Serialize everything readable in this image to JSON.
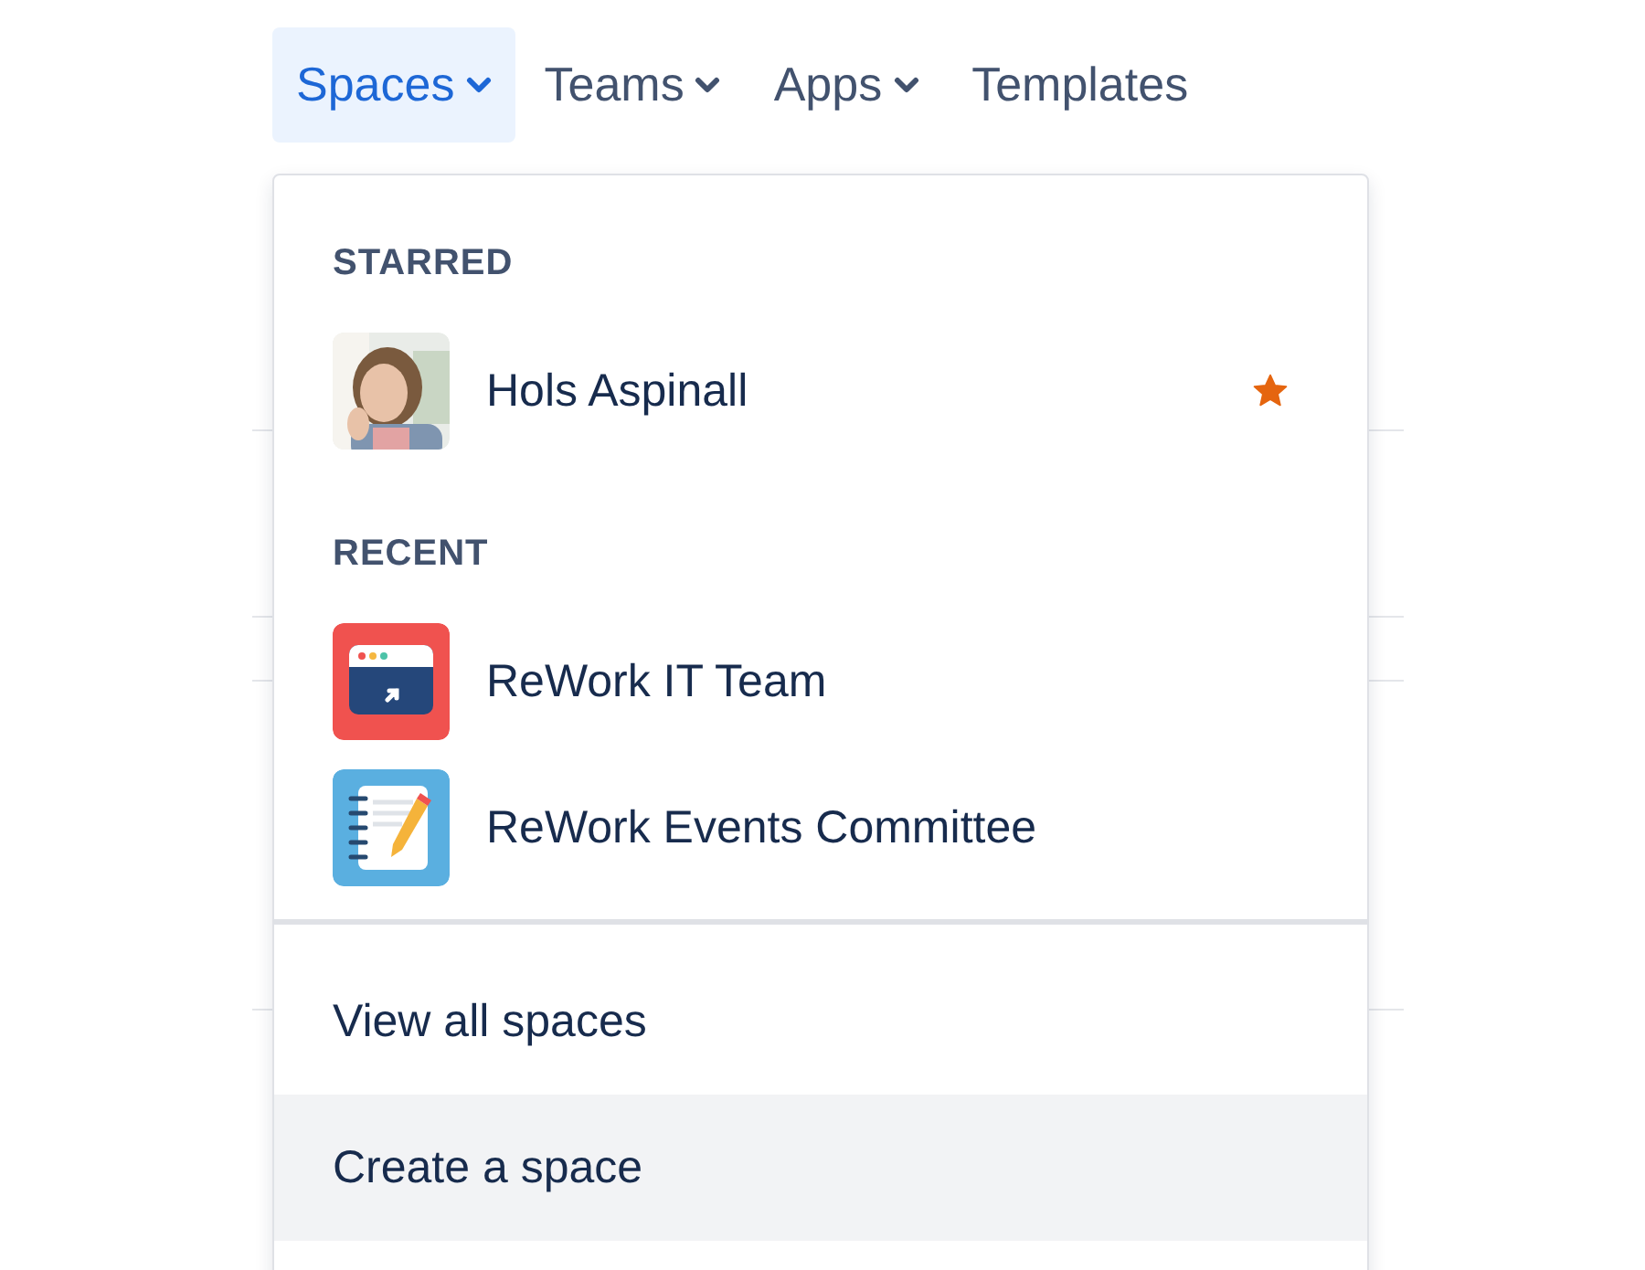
{
  "nav": [
    {
      "label": "Spaces",
      "dropdown": true,
      "selected": true
    },
    {
      "label": "Teams",
      "dropdown": true,
      "selected": false
    },
    {
      "label": "Apps",
      "dropdown": true,
      "selected": false
    },
    {
      "label": "Templates",
      "dropdown": false,
      "selected": false
    }
  ],
  "menu": {
    "sections": [
      {
        "heading": "STARRED",
        "items": [
          {
            "name": "Hols Aspinall",
            "kind": "picture",
            "starred": true
          }
        ]
      },
      {
        "heading": "RECENT",
        "items": [
          {
            "name": "ReWork IT Team",
            "kind": "browser",
            "starred": false
          },
          {
            "name": "ReWork Events Committee",
            "kind": "notebook",
            "starred": false
          }
        ]
      }
    ],
    "actions": [
      {
        "label": "View all spaces",
        "selected": false
      },
      {
        "label": "Create a space",
        "selected": true
      }
    ]
  }
}
